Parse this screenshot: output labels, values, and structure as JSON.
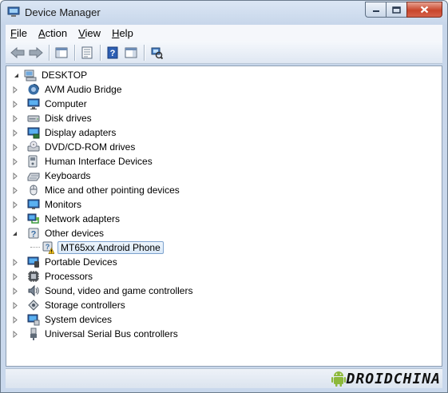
{
  "window": {
    "title": "Device Manager"
  },
  "menu": [
    {
      "first": "F",
      "rest": "ile"
    },
    {
      "first": "A",
      "rest": "ction"
    },
    {
      "first": "V",
      "rest": "iew"
    },
    {
      "first": "H",
      "rest": "elp"
    }
  ],
  "tree": {
    "root": "DESKTOP",
    "categories": [
      {
        "label": "AVM Audio Bridge",
        "icon": "audio-bridge-icon"
      },
      {
        "label": "Computer",
        "icon": "computer-icon"
      },
      {
        "label": "Disk drives",
        "icon": "disk-drive-icon"
      },
      {
        "label": "Display adapters",
        "icon": "display-adapter-icon"
      },
      {
        "label": "DVD/CD-ROM drives",
        "icon": "dvd-drive-icon"
      },
      {
        "label": "Human Interface Devices",
        "icon": "hid-icon"
      },
      {
        "label": "Keyboards",
        "icon": "keyboard-icon"
      },
      {
        "label": "Mice and other pointing devices",
        "icon": "mouse-icon"
      },
      {
        "label": "Monitors",
        "icon": "monitor-icon"
      },
      {
        "label": "Network adapters",
        "icon": "network-adapter-icon"
      },
      {
        "label": "Other devices",
        "icon": "other-devices-icon",
        "expanded": true
      },
      {
        "label": "MT65xx Android Phone",
        "icon": "warning-device-icon",
        "child": true,
        "selected": true
      },
      {
        "label": "Portable Devices",
        "icon": "portable-device-icon"
      },
      {
        "label": "Processors",
        "icon": "processor-icon"
      },
      {
        "label": "Sound, video and game controllers",
        "icon": "sound-icon"
      },
      {
        "label": "Storage controllers",
        "icon": "storage-controller-icon"
      },
      {
        "label": "System devices",
        "icon": "system-devices-icon"
      },
      {
        "label": "Universal Serial Bus controllers",
        "icon": "usb-icon"
      }
    ]
  },
  "watermark": {
    "text": "DROIDCHINA"
  },
  "colors": {
    "accent": "#3a6ea5",
    "selection": "#d9e8f7",
    "warning": "#f2c21a",
    "android": "#8cb83a"
  }
}
